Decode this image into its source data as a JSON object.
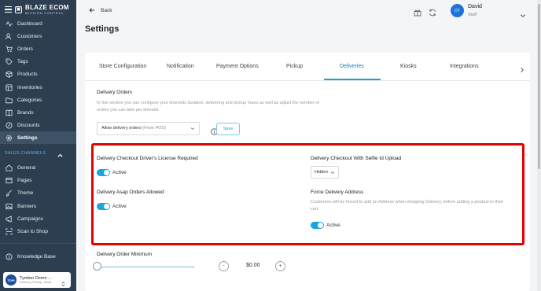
{
  "sidebar": {
    "brand": {
      "name": "BLAZE ECOM",
      "tagline": "MISSION CONTROL"
    },
    "items": [
      {
        "label": "Dashboard",
        "icon": "activity-icon"
      },
      {
        "label": "Customers",
        "icon": "users-icon"
      },
      {
        "label": "Orders",
        "icon": "cart-icon"
      },
      {
        "label": "Tags",
        "icon": "tag-icon"
      },
      {
        "label": "Products",
        "icon": "box-icon"
      },
      {
        "label": "Inventories",
        "icon": "layers-icon"
      },
      {
        "label": "Categories",
        "icon": "folder-icon"
      },
      {
        "label": "Brands",
        "icon": "book-icon"
      },
      {
        "label": "Discounts",
        "icon": "discount-icon"
      },
      {
        "label": "Settings",
        "icon": "gear-icon",
        "active": true
      }
    ],
    "section_label": "SALES CHANNELS",
    "channel_items": [
      {
        "label": "General",
        "icon": "home-icon"
      },
      {
        "label": "Pages",
        "icon": "pages-icon"
      },
      {
        "label": "Theme",
        "icon": "brush-icon"
      },
      {
        "label": "Banners",
        "icon": "image-icon"
      },
      {
        "label": "Campaigns",
        "icon": "megaphone-icon"
      },
      {
        "label": "Scan to Shop",
        "icon": "scan-icon"
      }
    ],
    "knowledge_base": "Knowledge Base",
    "store": {
      "avatar": "TDPI",
      "name": "Tymber Demo ...",
      "subtitle": "Delivery, Pickup, Kiosk"
    }
  },
  "header": {
    "back_label": "Back",
    "user": {
      "initials": "DT",
      "name": "David",
      "role": "Staff"
    }
  },
  "page_title": "Settings",
  "tabs": [
    {
      "label": "Store Configuration"
    },
    {
      "label": "Notification"
    },
    {
      "label": "Payment Options"
    },
    {
      "label": "Pickup"
    },
    {
      "label": "Deliveries",
      "active": true
    },
    {
      "label": "Kiosks"
    },
    {
      "label": "Integrations"
    }
  ],
  "delivery_orders": {
    "title": "Delivery Orders",
    "description": "In this section you can configure your timeslots duration, delivering and pickup hours as well as adjust the number of orders you can take per timeslot.",
    "select_value": "Allow delivery orders",
    "select_suffix": "(From POS)",
    "save_label": "Save"
  },
  "highlight": {
    "license_title": "Delivery Checkout Driver's License Required",
    "license_status": "Active",
    "asap_title": "Delivery Asap Orders Allowed",
    "asap_status": "Active",
    "selfie_title": "Delivery Checkout With Selfie Id Upload",
    "selfie_value": "Hidden",
    "force_title": "Force Delivery Address",
    "force_description": "Customers will be forced to add an Address when shopping Delivery, before adding a product to their cart.",
    "force_status": "Active"
  },
  "order_minimum": {
    "title": "Delivery Order Minimum",
    "value": "$0.00",
    "minus": "-",
    "plus": "+"
  },
  "colors": {
    "accent": "#1da2dc",
    "sidebar": "#2c3e50",
    "highlight": "#e60000"
  }
}
